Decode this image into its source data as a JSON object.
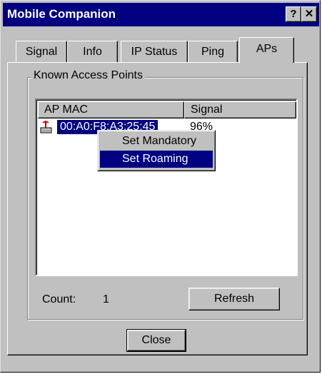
{
  "window": {
    "title": "Mobile Companion",
    "help_button": "?",
    "close_button": "✕"
  },
  "tabs": [
    {
      "label": "Signal",
      "active": false
    },
    {
      "label": "Info",
      "active": false
    },
    {
      "label": "IP Status",
      "active": false
    },
    {
      "label": "Ping",
      "active": false
    },
    {
      "label": "APs",
      "active": true
    }
  ],
  "group": {
    "label": "Known Access Points"
  },
  "list": {
    "columns": [
      "AP MAC",
      "Signal"
    ],
    "rows": [
      {
        "mac": "00:A0:F8:A3:25:45",
        "signal": "96%",
        "icon": "access-point-icon",
        "selected": true
      }
    ]
  },
  "context_menu": {
    "items": [
      {
        "label": "Set Mandatory",
        "selected": false
      },
      {
        "label": "Set Roaming",
        "selected": true
      }
    ]
  },
  "footer": {
    "count_label": "Count:",
    "count_value": "1",
    "refresh_label": "Refresh",
    "close_label": "Close"
  },
  "colors": {
    "face": "#c0c0c0",
    "title_bar": "#000080",
    "selection": "#000080"
  }
}
